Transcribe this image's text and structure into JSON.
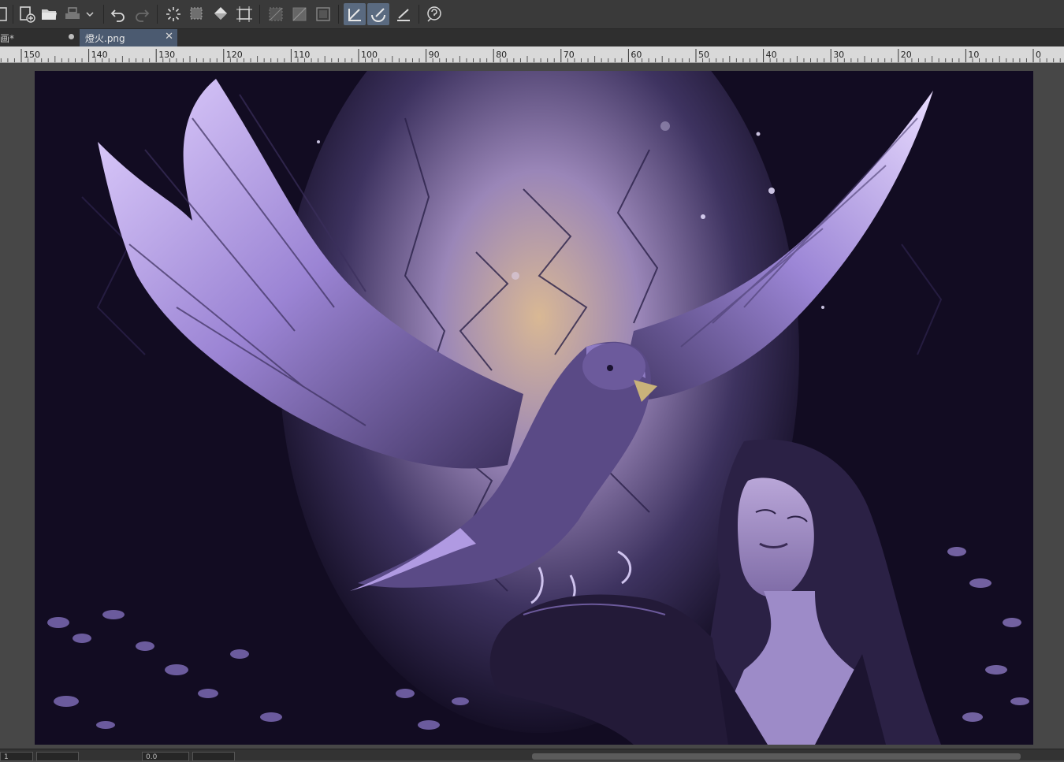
{
  "toolbar": {
    "icons": [
      "new-document-icon",
      "open-folder-icon",
      "print-icon",
      "dropdown-chevron-icon",
      "undo-icon",
      "redo-icon",
      "deselect-icon",
      "selection-icon",
      "fill-bucket-icon",
      "transform-icon",
      "clear-icon",
      "clear-outside-icon",
      "select-all-icon",
      "snap-ruler-icon",
      "snap-special-ruler-icon",
      "ruler-line-icon",
      "help-icon"
    ]
  },
  "tabs": [
    {
      "label": "画*",
      "state": "inactive"
    },
    {
      "label": "燈火.png",
      "state": "active"
    }
  ],
  "ruler": {
    "labels": [
      "150",
      "140",
      "130",
      "120",
      "110",
      "100",
      "90",
      "80",
      "70",
      "60",
      "50",
      "40",
      "30",
      "20",
      "10",
      "0"
    ]
  },
  "artwork": {
    "description_colors": {
      "background": "#140e24",
      "glow": "#e6c7a0",
      "wing_light": "#c9b3ff",
      "wing_shadow": "#3b2f5c"
    }
  },
  "statusbar": {
    "zoom_field": "0.0",
    "left_field": "1"
  }
}
